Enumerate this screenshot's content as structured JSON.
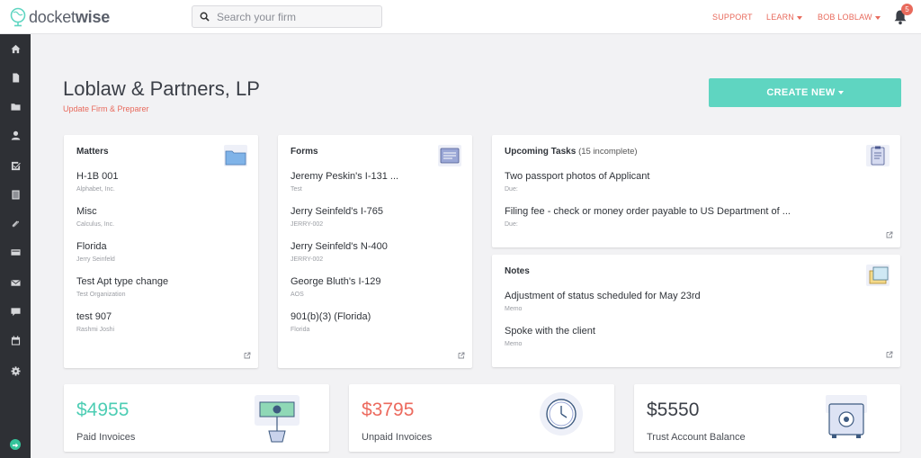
{
  "app": {
    "logo_light": "docket",
    "logo_bold": "wise"
  },
  "search": {
    "placeholder": "Search your firm"
  },
  "topnav": {
    "support": "SUPPORT",
    "learn": "LEARN",
    "user": "BOB LOBLAW",
    "notification_count": "5"
  },
  "sidebar": {
    "icons": [
      "home-icon",
      "document-icon",
      "folder-icon",
      "user-icon",
      "task-check-icon",
      "forms-icon",
      "paperclip-icon",
      "credit-card-icon",
      "envelope-icon",
      "chat-icon",
      "calendar-icon",
      "gear-icon"
    ]
  },
  "header": {
    "firm_name": "Loblaw & Partners, LP",
    "update_link": "Update Firm & Preparer",
    "create_button": "CREATE NEW"
  },
  "matters": {
    "title": "Matters",
    "items": [
      {
        "name": "H-1B 001",
        "sub": "Alphabet, Inc."
      },
      {
        "name": "Misc",
        "sub": "Calculus, Inc."
      },
      {
        "name": "Florida",
        "sub": "Jerry Seinfeld"
      },
      {
        "name": "Test Apt type change",
        "sub": "Test Organization"
      },
      {
        "name": "test 907",
        "sub": "Rashmi Joshi"
      }
    ]
  },
  "forms": {
    "title": "Forms",
    "items": [
      {
        "name": "Jeremy Peskin's I-131 ...",
        "sub": "Test"
      },
      {
        "name": "Jerry Seinfeld's I-765",
        "sub": "JERRY-002"
      },
      {
        "name": "Jerry Seinfeld's N-400",
        "sub": "JERRY-002"
      },
      {
        "name": "George Bluth's I-129",
        "sub": "AOS"
      },
      {
        "name": "901(b)(3) (Florida)",
        "sub": "Florida"
      }
    ]
  },
  "tasks": {
    "title": "Upcoming Tasks",
    "count": "(15 incomplete)",
    "items": [
      {
        "name": "Two passport photos of Applicant",
        "sub": "Due:"
      },
      {
        "name": "Filing fee - check or money order payable to US Department of ...",
        "sub": "Due:"
      }
    ]
  },
  "notes": {
    "title": "Notes",
    "items": [
      {
        "name": "Adjustment of status scheduled for May 23rd",
        "sub": "Memo"
      },
      {
        "name": "Spoke with the client",
        "sub": "Memo"
      }
    ]
  },
  "stats": {
    "paid": {
      "value": "$4955",
      "label": "Paid Invoices",
      "color": "#4dcdb4"
    },
    "unpaid": {
      "value": "$3795",
      "label": "Unpaid Invoices",
      "color": "#ec6a5e"
    },
    "trust": {
      "value": "$5550",
      "label": "Trust Account Balance",
      "color": "#3b3f47"
    }
  },
  "colors": {
    "accent": "#5fd5c1",
    "link": "#e86a5c",
    "sidebar": "#2e3035"
  }
}
